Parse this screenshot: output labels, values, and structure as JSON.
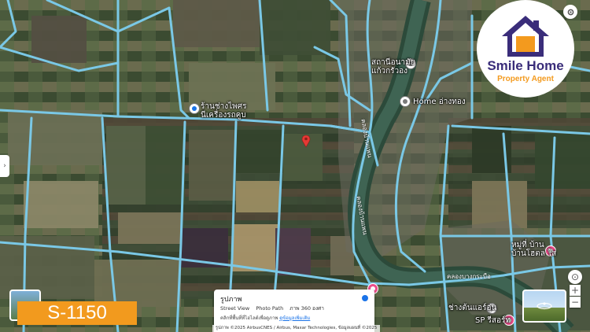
{
  "map": {
    "pois": [
      {
        "name": "ร้านช่างไพศร\nนีเครื่องรถคูบ",
        "kind": "blue"
      },
      {
        "name": "สถานีอนามัย\nแก้วกรัวอง",
        "kind": "gray"
      },
      {
        "name": "Home อ่างทอง",
        "kind": "gray"
      },
      {
        "name": "หมู่ที่ บ้าน\nบ้านโฮตล ใส",
        "kind": "pink"
      },
      {
        "name": "ช่างต้นแอร์อุ่น",
        "kind": "gray"
      },
      {
        "name": "SP รีสอร์ท",
        "kind": "gray"
      }
    ],
    "road_labels": [
      "คลองบ้านแพน",
      "คลองบ้านแพน",
      "คลองบางกระบือ"
    ],
    "marker": {
      "type": "selected-location-pin",
      "color": "#e53935"
    },
    "road_color": "#7ac8e6"
  },
  "logo": {
    "line1": "Smile Home",
    "line2": "Property Agent",
    "house_color": "#3a2d7a",
    "door_color": "#f39a1e"
  },
  "code": "S-1150",
  "street_view_card": {
    "title": "รูปภาพ",
    "options": [
      "Street View",
      "Photo Path",
      "ภาพ 360 องศา"
    ],
    "hint_prefix": "คลิกที่พื้นที่ที่ไฮไลต์เพื่อดูภาพ ",
    "hint_link": "ดูข้อมูลเพิ่มเติม"
  },
  "attribution": "รูปภาพ ©2025 AirbusCNES / Airbus, Maxar Technologies, ข้อมูลแผนที่ ©2025",
  "controls": {
    "zoom_in": "+",
    "zoom_out": "−",
    "locate": "⊙",
    "side_tab": "›"
  }
}
